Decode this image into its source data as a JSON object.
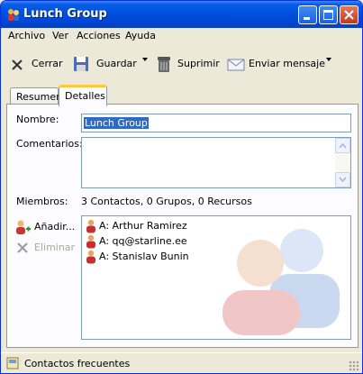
{
  "window": {
    "title": "Lunch Group"
  },
  "menu": {
    "items": [
      "Archivo",
      "Ver",
      "Acciones",
      "Ayuda"
    ]
  },
  "toolbar": {
    "close_label": "Cerrar",
    "save_label": "Guardar",
    "delete_label": "Suprimir",
    "send_label": "Enviar mensaje"
  },
  "tabs": [
    {
      "label": "Resumen"
    },
    {
      "label": "Detalles"
    }
  ],
  "form": {
    "name_label": "Nombre:",
    "name_value": "Lunch Group",
    "comments_label": "Comentarios:",
    "comments_value": "",
    "members_label": "Miembros:",
    "members_summary": "3 Contactos, 0 Grupos, 0 Recursos"
  },
  "members": {
    "add_label": "Añadir...",
    "remove_label": "Eliminar",
    "items": [
      {
        "text": "A: Arthur Ramirez"
      },
      {
        "text": "A: qq@starline.ee"
      },
      {
        "text": "A: Stanislav Bunin"
      }
    ]
  },
  "status": {
    "text": "Contactos frecuentes"
  },
  "colors": {
    "titlebar": "#0052e0",
    "selection": "#316ac5",
    "tab_accent": "#ffc73c",
    "background": "#ece9d8"
  },
  "icons": {
    "title": "contact-group-icon",
    "close": "close-x-icon",
    "save": "floppy-disk-icon",
    "delete": "trash-can-icon",
    "send": "envelope-icon",
    "member": "person-icon",
    "add": "add-person-icon",
    "remove": "delete-x-icon",
    "status": "address-book-icon"
  }
}
